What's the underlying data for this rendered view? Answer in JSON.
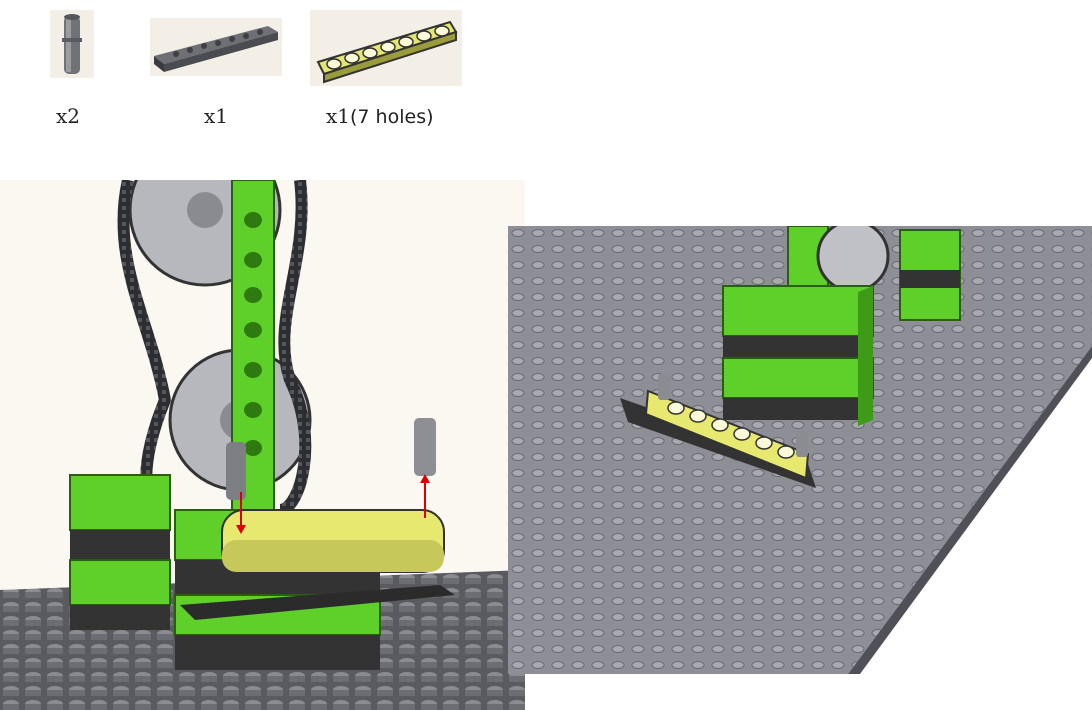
{
  "parts": [
    {
      "name": "pin",
      "qty": "x2",
      "note": ""
    },
    {
      "name": "plate",
      "qty": "x1",
      "note": ""
    },
    {
      "name": "beam",
      "qty": "x1",
      "note": "(7 holes)"
    }
  ],
  "colors": {
    "green": "#5fcf2a",
    "dark_green": "#3d9b18",
    "black": "#2b2b2b",
    "gray": "#8a8c92",
    "light_gray": "#b8bac0",
    "yellow": "#e8ea7a",
    "baseplate": "#8d8e96"
  }
}
